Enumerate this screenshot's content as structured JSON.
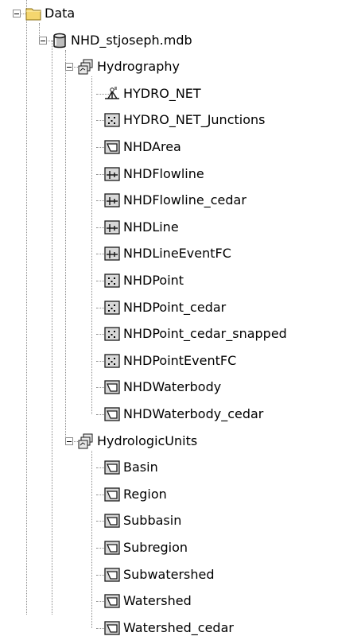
{
  "tree": {
    "root": {
      "label": "Data",
      "icon": "folder-icon",
      "children": [
        {
          "label": "NHD_stjoseph.mdb",
          "icon": "database-icon",
          "children": [
            {
              "label": "Hydrography",
              "icon": "feature-dataset-icon",
              "children": [
                {
                  "label": "HYDRO_NET",
                  "icon": "geometric-network-icon"
                },
                {
                  "label": "HYDRO_NET_Junctions",
                  "icon": "point-feature-class-icon"
                },
                {
                  "label": "NHDArea",
                  "icon": "polygon-feature-class-icon"
                },
                {
                  "label": "NHDFlowline",
                  "icon": "line-feature-class-icon"
                },
                {
                  "label": "NHDFlowline_cedar",
                  "icon": "line-feature-class-icon"
                },
                {
                  "label": "NHDLine",
                  "icon": "line-feature-class-icon"
                },
                {
                  "label": "NHDLineEventFC",
                  "icon": "line-feature-class-icon"
                },
                {
                  "label": "NHDPoint",
                  "icon": "point-feature-class-icon"
                },
                {
                  "label": "NHDPoint_cedar",
                  "icon": "point-feature-class-icon"
                },
                {
                  "label": "NHDPoint_cedar_snapped",
                  "icon": "point-feature-class-icon"
                },
                {
                  "label": "NHDPointEventFC",
                  "icon": "point-feature-class-icon"
                },
                {
                  "label": "NHDWaterbody",
                  "icon": "polygon-feature-class-icon"
                },
                {
                  "label": "NHDWaterbody_cedar",
                  "icon": "polygon-feature-class-icon"
                }
              ]
            },
            {
              "label": "HydrologicUnits",
              "icon": "feature-dataset-icon",
              "children": [
                {
                  "label": "Basin",
                  "icon": "polygon-feature-class-icon"
                },
                {
                  "label": "Region",
                  "icon": "polygon-feature-class-icon"
                },
                {
                  "label": "Subbasin",
                  "icon": "polygon-feature-class-icon"
                },
                {
                  "label": "Subregion",
                  "icon": "polygon-feature-class-icon"
                },
                {
                  "label": "Subwatershed",
                  "icon": "polygon-feature-class-icon"
                },
                {
                  "label": "Watershed",
                  "icon": "polygon-feature-class-icon"
                },
                {
                  "label": "Watershed_cedar",
                  "icon": "polygon-feature-class-icon"
                }
              ]
            }
          ]
        }
      ]
    }
  },
  "colors": {
    "tree_lines": "#8c8c8c",
    "folder": "#f4d66e",
    "icon_fill": "#d8d8d8",
    "icon_stroke": "#1a1a1a"
  }
}
